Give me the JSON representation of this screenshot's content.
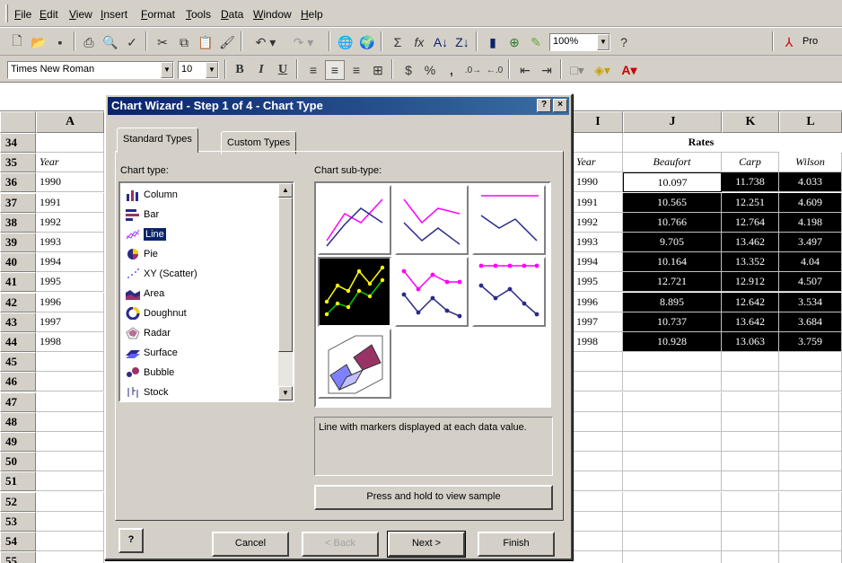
{
  "menu": [
    "File",
    "Edit",
    "View",
    "Insert",
    "Format",
    "Tools",
    "Data",
    "Window",
    "Help"
  ],
  "toolbar": {
    "zoom": "100%",
    "acrobat_label": "Pro"
  },
  "format": {
    "font": "Times New Roman",
    "size": "10",
    "bold": "B",
    "italic": "I",
    "underline": "U",
    "currency": "$",
    "percent": "%",
    "comma": ","
  },
  "columns": {
    "A": "A",
    "I": "I",
    "J": "J",
    "K": "K",
    "L": "L"
  },
  "rows": [
    "34",
    "35",
    "36",
    "37",
    "38",
    "39",
    "40",
    "41",
    "42",
    "43",
    "44",
    "45",
    "46",
    "47",
    "48",
    "49",
    "50",
    "51",
    "52",
    "53",
    "54",
    "55"
  ],
  "sheet": {
    "rates_header": "Rates",
    "year_header": "Year",
    "col_headers": [
      "Beaufort",
      "Carp",
      "Wilson"
    ],
    "left_years": [
      "1990",
      "1991",
      "1992",
      "1993",
      "1994",
      "1995",
      "1996",
      "1997",
      "1998"
    ],
    "right_rows": [
      [
        "1990",
        "10.097",
        "11.738",
        "4.033"
      ],
      [
        "1991",
        "10.565",
        "12.251",
        "4.609"
      ],
      [
        "1992",
        "10.766",
        "12.764",
        "4.198"
      ],
      [
        "1993",
        "9.705",
        "13.462",
        "3.497"
      ],
      [
        "1994",
        "10.164",
        "13.352",
        "4.04"
      ],
      [
        "1995",
        "12.721",
        "12.912",
        "4.507"
      ],
      [
        "1996",
        "8.895",
        "12.642",
        "3.534"
      ],
      [
        "1997",
        "10.737",
        "13.642",
        "3.684"
      ],
      [
        "1998",
        "10.928",
        "13.063",
        "3.759"
      ]
    ],
    "left_col_b_partial": "J"
  },
  "dialog": {
    "title": "Chart Wizard - Step 1 of 4 - Chart Type",
    "help_box": "?",
    "close_box": "×",
    "tabs": [
      "Standard Types",
      "Custom Types"
    ],
    "chart_type_label": "Chart type:",
    "subtype_label": "Chart sub-type:",
    "chart_types": [
      "Column",
      "Bar",
      "Line",
      "Pie",
      "XY (Scatter)",
      "Area",
      "Doughnut",
      "Radar",
      "Surface",
      "Bubble",
      "Stock"
    ],
    "selected_type": "Line",
    "description": "Line with markers displayed at each data value.",
    "sample_button": "Press and hold to view sample",
    "buttons": {
      "help": "?",
      "cancel": "Cancel",
      "back": "< Back",
      "next": "Next >",
      "finish": "Finish"
    }
  },
  "colors": {
    "selection": "#0a246a",
    "titlebar": "#0a246a",
    "face": "#d4d0c8"
  }
}
